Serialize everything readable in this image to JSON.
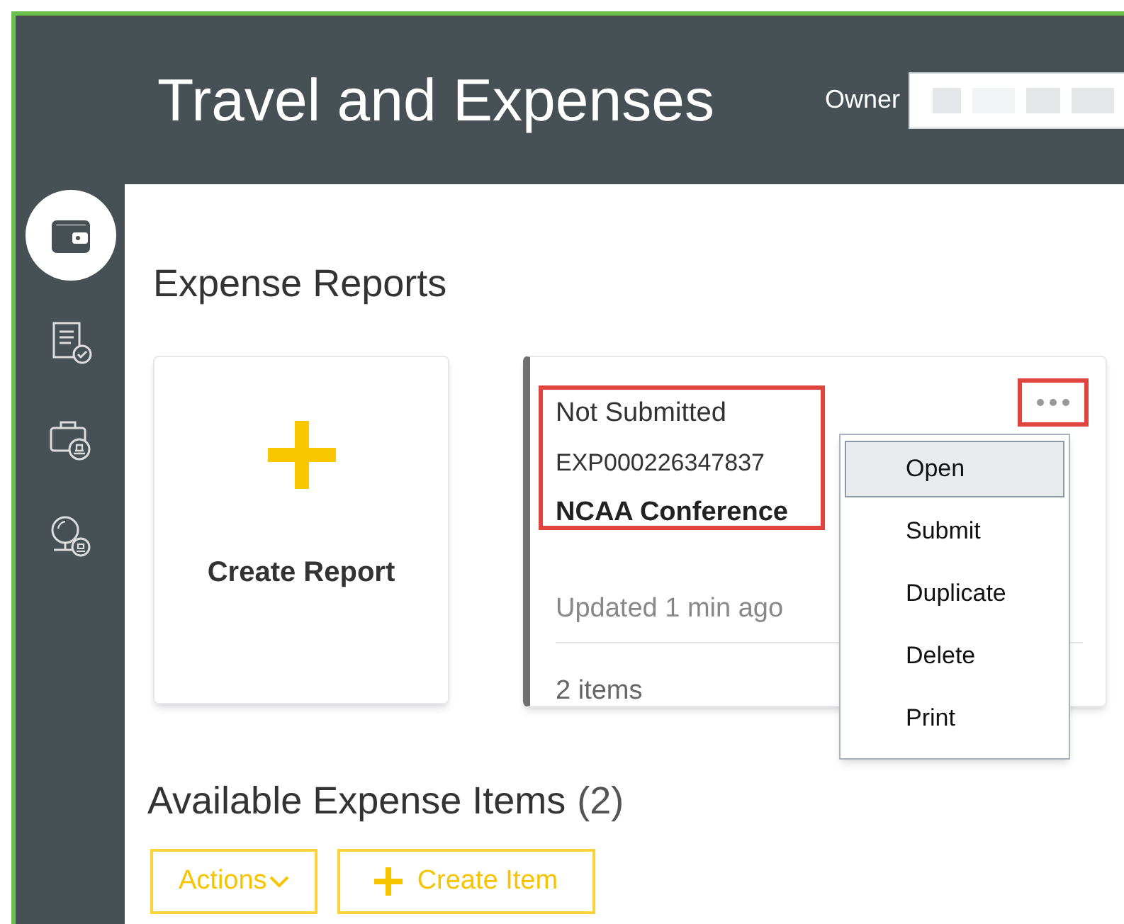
{
  "header": {
    "title": "Travel and Expenses",
    "owner_label": "Owner"
  },
  "sidebar": {
    "items": [
      {
        "kind": "wallet",
        "selected": true
      },
      {
        "kind": "report",
        "selected": false
      },
      {
        "kind": "briefcase",
        "selected": false
      },
      {
        "kind": "globe",
        "selected": false
      }
    ]
  },
  "expense_reports": {
    "title": "Expense Reports",
    "create_card": {
      "label": "Create Report"
    },
    "report": {
      "status": "Not Submitted",
      "number": "EXP000226347837",
      "name": "NCAA Conference",
      "updated": "Updated 1 min ago",
      "items": "2 items",
      "menu": [
        {
          "label": "Open",
          "selected": true
        },
        {
          "label": "Submit",
          "selected": false
        },
        {
          "label": "Duplicate",
          "selected": false
        },
        {
          "label": "Delete",
          "selected": false
        },
        {
          "label": "Print",
          "selected": false
        }
      ]
    }
  },
  "available_items": {
    "title": "Available Expense Items",
    "count": "(2)",
    "buttons": [
      {
        "kind": "dropdown",
        "label": "Actions"
      },
      {
        "kind": "create",
        "label": "Create Item"
      }
    ]
  }
}
